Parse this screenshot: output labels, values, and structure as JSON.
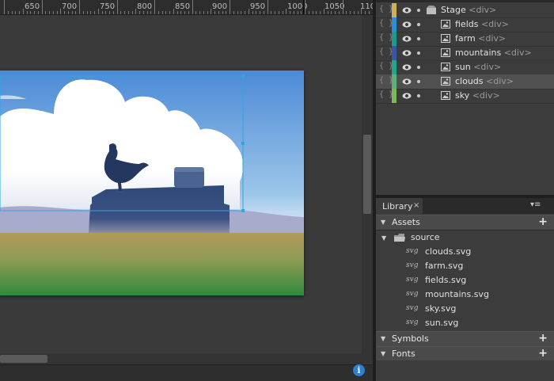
{
  "ruler": {
    "labels": [
      "650",
      "700",
      "750",
      "800",
      "850",
      "900",
      "950",
      "1000",
      "1050",
      "110"
    ]
  },
  "layers": [
    {
      "name": "Stage",
      "tag": "<div>",
      "color": "#c9b35a",
      "icon": "stage-icon",
      "selected": false
    },
    {
      "name": "fields",
      "tag": "<div>",
      "color": "#2a8fd8",
      "icon": "image-icon",
      "selected": false
    },
    {
      "name": "farm",
      "tag": "<div>",
      "color": "#1e9a8c",
      "icon": "image-icon",
      "selected": false
    },
    {
      "name": "mountains",
      "tag": "<div>",
      "color": "#3b55a8",
      "icon": "image-icon",
      "selected": false
    },
    {
      "name": "sun",
      "tag": "<div>",
      "color": "#22a58a",
      "icon": "image-icon",
      "selected": false
    },
    {
      "name": "clouds",
      "tag": "<div>",
      "color": "#5fb07a",
      "icon": "image-icon",
      "selected": true
    },
    {
      "name": "sky",
      "tag": "<div>",
      "color": "#7fb85a",
      "icon": "image-icon",
      "selected": false
    }
  ],
  "library": {
    "tab_label": "Library",
    "close_glyph": "×",
    "menu_glyph": "▾≡",
    "sections": {
      "assets": "Assets",
      "symbols": "Symbols",
      "fonts": "Fonts"
    },
    "plus_glyph": "+",
    "folder_name": "source",
    "svg_tag": "svg",
    "files": [
      "clouds.svg",
      "farm.svg",
      "fields.svg",
      "mountains.svg",
      "sky.svg",
      "sun.svg"
    ]
  },
  "status": {
    "info_glyph": "i"
  },
  "colors": {
    "panel_bg": "#3c3c3c",
    "selection": "#2ea6e0",
    "info_blue": "#2f7fd0"
  }
}
